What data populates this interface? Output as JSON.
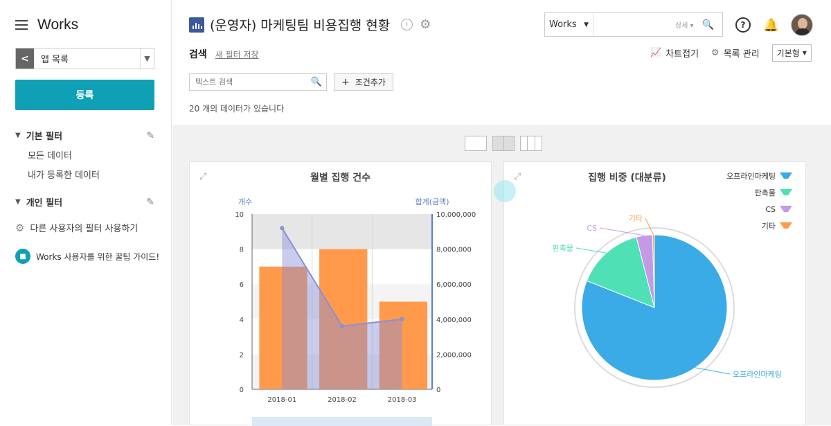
{
  "sidebar": {
    "brand": "Works",
    "app_select": "앱 목록",
    "register": "등록",
    "basic_filter": {
      "title": "기본 필터",
      "items": [
        "모든 데이터",
        "내가 등록한 데이터"
      ]
    },
    "personal_filter": {
      "title": "개인 필터"
    },
    "other_filter": "다른 사용자의 필터 사용하기",
    "guide": "Works 사용자를 위한 꿀팁 가이드!"
  },
  "header": {
    "title": "(운영자) 마케팅팀 비용집행 현황",
    "search_scope": "Works",
    "search_detail": "상세",
    "search_label": "검색",
    "save_filter": "새 필터 저장",
    "fold_chart": "차트접기",
    "list_manage": "목록 관리",
    "view_mode": "기본형",
    "text_search_placeholder": "텍스트 검색",
    "add_condition": "조건추가",
    "count_text": "20 개의 데이터가 있습니다"
  },
  "colors": {
    "accent": "#10a0b5",
    "bar": "#ff9a4d",
    "line": "#8a8fd8",
    "pie_marketing": "#3aabe6",
    "pie_shop": "#4fe0b6",
    "pie_cs": "#c49ae6",
    "pie_etc": "#ff9a4d"
  },
  "chart_data": [
    {
      "type": "bar",
      "title": "월별 집행 건수",
      "categories": [
        "2018-01",
        "2018-02",
        "2018-03"
      ],
      "ylabel": "개수",
      "y2label": "합계(금액)",
      "ylim": [
        0,
        10
      ],
      "y2lim": [
        0,
        10000000
      ],
      "yticks": [
        "0",
        "2",
        "4",
        "6",
        "8",
        "10"
      ],
      "y2ticks": [
        "0",
        "2,000,000",
        "4,000,000",
        "6,000,000",
        "8,000,000",
        "10,000,000"
      ],
      "series": [
        {
          "values": [
            7,
            8,
            5
          ]
        },
        {
          "values": [
            9200000,
            3600000,
            4000000
          ]
        }
      ]
    },
    {
      "type": "pie",
      "title": "집행 비중 (대분류)",
      "labels": [
        "오프라인마케팅",
        "판촉물",
        "CS",
        "기타"
      ],
      "values": [
        81,
        15,
        3.6,
        0.4
      ],
      "legend": "top-right"
    }
  ]
}
